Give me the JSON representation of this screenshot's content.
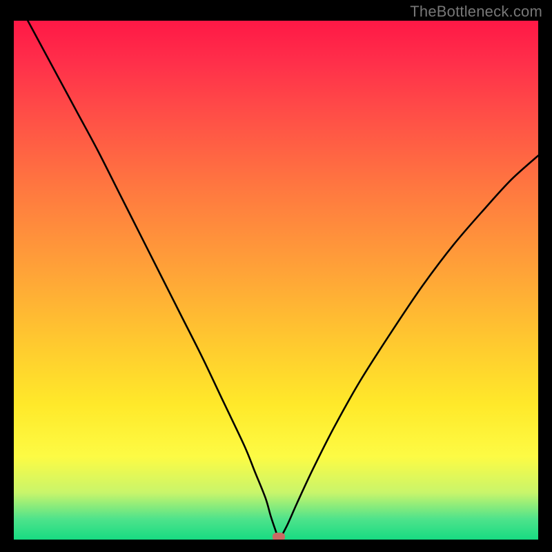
{
  "watermark": "TheBottleneck.com",
  "colors": {
    "frame": "#000000",
    "curve": "#000000",
    "marker": "#c96b63",
    "gradient_top": "#ff1846",
    "gradient_bottom": "#17db82"
  },
  "chart_data": {
    "type": "line",
    "title": "",
    "xlabel": "",
    "ylabel": "",
    "xlim": [
      0,
      100
    ],
    "ylim": [
      0,
      100
    ],
    "grid": false,
    "legend": false,
    "annotations": [
      {
        "type": "marker",
        "x": 50.5,
        "y": 0.5,
        "shape": "oval",
        "color": "#c96b63"
      }
    ],
    "series": [
      {
        "name": "bottleneck-curve",
        "color": "#000000",
        "x": [
          0,
          4,
          8,
          12,
          16,
          20,
          24,
          28,
          32,
          36,
          40,
          44,
          46,
          48,
          49,
          50,
          50.5,
          52,
          54,
          57,
          61,
          66,
          72,
          78,
          84,
          90,
          95,
          100
        ],
        "y": [
          105,
          97.5,
          90,
          82.5,
          75,
          67,
          59,
          51,
          43,
          35,
          26.5,
          18,
          13,
          8,
          4.5,
          1.5,
          0,
          2.5,
          7,
          13.5,
          21.5,
          30.5,
          40,
          49,
          57,
          64,
          69.5,
          74
        ]
      }
    ]
  }
}
